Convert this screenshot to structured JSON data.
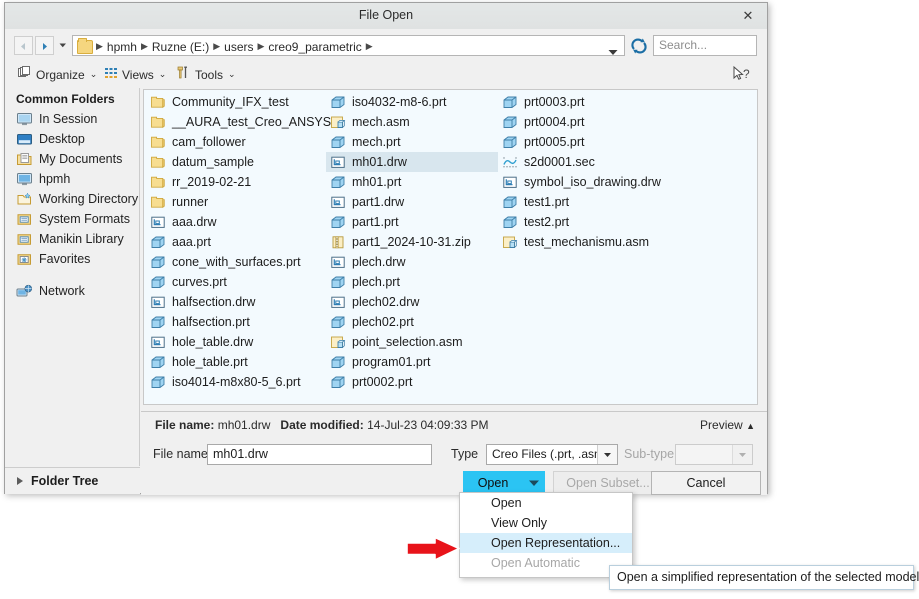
{
  "window": {
    "title": "File Open",
    "close_label": "✕"
  },
  "address": {
    "back_icon": "back-arrow-icon",
    "forward_icon": "forward-arrow-icon",
    "history_icon": "chevron-down-icon",
    "crumbs": [
      "hpmh",
      "Ruzne (E:)",
      "users",
      "creo9_parametric"
    ],
    "separator": "▶",
    "dropdown_icon": "chevron-down-icon",
    "refresh_icon": "refresh-icon",
    "search_placeholder": "Search..."
  },
  "toolstrip": {
    "items": [
      {
        "label": "Organize",
        "icon": "organize-icon",
        "caret": "⌄"
      },
      {
        "label": "Views",
        "icon": "views-grid-icon",
        "caret": "⌄"
      },
      {
        "label": "Tools",
        "icon": "tools-hammer-icon",
        "caret": "⌄"
      }
    ],
    "help_icon": "cursor-help-icon"
  },
  "sidebar": {
    "header": "Common Folders",
    "items": [
      {
        "label": "In Session",
        "icon": "monitor-icon"
      },
      {
        "label": "Desktop",
        "icon": "desktop-icon"
      },
      {
        "label": "My Documents",
        "icon": "documents-folder-icon"
      },
      {
        "label": "hpmh",
        "icon": "monitor-icon"
      },
      {
        "label": "Working Directory",
        "icon": "working-folder-icon"
      },
      {
        "label": "System Formats",
        "icon": "formats-folder-icon"
      },
      {
        "label": "Manikin Library",
        "icon": "library-folder-icon"
      },
      {
        "label": "Favorites",
        "icon": "favorites-folder-icon"
      }
    ],
    "network": {
      "label": "Network",
      "icon": "network-icon"
    },
    "folder_tree": {
      "label": "Folder Tree",
      "expander": "▶"
    }
  },
  "filelist": {
    "columns": [
      [
        {
          "name": "Community_IFX_test",
          "icon": "folder-icon",
          "selected": false
        },
        {
          "name": "__AURA_test_Creo_ANSYS",
          "icon": "folder-icon",
          "selected": false
        },
        {
          "name": "cam_follower",
          "icon": "folder-icon",
          "selected": false
        },
        {
          "name": "datum_sample",
          "icon": "folder-icon",
          "selected": false
        },
        {
          "name": "rr_2019-02-21",
          "icon": "folder-icon",
          "selected": false
        },
        {
          "name": "runner",
          "icon": "folder-icon",
          "selected": false
        },
        {
          "name": "aaa.drw",
          "icon": "drawing-icon",
          "selected": false
        },
        {
          "name": "aaa.prt",
          "icon": "part-icon",
          "selected": false
        },
        {
          "name": "cone_with_surfaces.prt",
          "icon": "part-icon",
          "selected": false
        },
        {
          "name": "curves.prt",
          "icon": "part-icon",
          "selected": false
        },
        {
          "name": "halfsection.drw",
          "icon": "drawing-icon",
          "selected": false
        },
        {
          "name": "halfsection.prt",
          "icon": "part-icon",
          "selected": false
        },
        {
          "name": "hole_table.drw",
          "icon": "drawing-icon",
          "selected": false
        },
        {
          "name": "hole_table.prt",
          "icon": "part-icon",
          "selected": false
        },
        {
          "name": "iso4014-m8x80-5_6.prt",
          "icon": "part-icon",
          "selected": false
        }
      ],
      [
        {
          "name": "iso4032-m8-6.prt",
          "icon": "part-icon",
          "selected": false
        },
        {
          "name": "mech.asm",
          "icon": "assembly-icon",
          "selected": false
        },
        {
          "name": "mech.prt",
          "icon": "part-icon",
          "selected": false
        },
        {
          "name": "mh01.drw",
          "icon": "drawing-icon",
          "selected": true
        },
        {
          "name": "mh01.prt",
          "icon": "part-icon",
          "selected": false
        },
        {
          "name": "part1.drw",
          "icon": "drawing-icon",
          "selected": false
        },
        {
          "name": "part1.prt",
          "icon": "part-icon",
          "selected": false
        },
        {
          "name": "part1_2024-10-31.zip",
          "icon": "zip-icon",
          "selected": false
        },
        {
          "name": "plech.drw",
          "icon": "drawing-icon",
          "selected": false
        },
        {
          "name": "plech.prt",
          "icon": "part-icon",
          "selected": false
        },
        {
          "name": "plech02.drw",
          "icon": "drawing-icon",
          "selected": false
        },
        {
          "name": "plech02.prt",
          "icon": "part-icon",
          "selected": false
        },
        {
          "name": "point_selection.asm",
          "icon": "assembly-icon",
          "selected": false
        },
        {
          "name": "program01.prt",
          "icon": "part-icon",
          "selected": false
        },
        {
          "name": "prt0002.prt",
          "icon": "part-icon",
          "selected": false
        }
      ],
      [
        {
          "name": "prt0003.prt",
          "icon": "part-icon",
          "selected": false
        },
        {
          "name": "prt0004.prt",
          "icon": "part-icon",
          "selected": false
        },
        {
          "name": "prt0005.prt",
          "icon": "part-icon",
          "selected": false
        },
        {
          "name": "s2d0001.sec",
          "icon": "sketch-icon",
          "selected": false
        },
        {
          "name": "symbol_iso_drawing.drw",
          "icon": "drawing-icon",
          "selected": false
        },
        {
          "name": "test1.prt",
          "icon": "part-icon",
          "selected": false
        },
        {
          "name": "test2.prt",
          "icon": "part-icon",
          "selected": false
        },
        {
          "name": "test_mechanismu.asm",
          "icon": "assembly-icon",
          "selected": false
        }
      ]
    ]
  },
  "details": {
    "file_name_label": "File name:",
    "file_name_value": "mh01.drw",
    "date_modified_label": "Date modified:",
    "date_modified_value": "14-Jul-23 04:09:33 PM",
    "preview_label": "Preview",
    "preview_caret": "▲"
  },
  "form": {
    "file_name_label": "File name:",
    "file_name_value": "mh01.drw",
    "type_label": "Type",
    "type_value": "Creo Files (.prt, .asm,",
    "subtype_label": "Sub-type",
    "subtype_value": ""
  },
  "buttons": {
    "open": "Open",
    "open_arrow_icon": "chevron-down-icon",
    "open_subset": "Open Subset...",
    "cancel": "Cancel"
  },
  "dropdown_menu": {
    "items": [
      {
        "label": "Open",
        "highlighted": false,
        "disabled": false
      },
      {
        "label": "View Only",
        "highlighted": false,
        "disabled": false
      },
      {
        "label": "Open Representation...",
        "highlighted": true,
        "disabled": false
      },
      {
        "label": "Open Automatic",
        "highlighted": false,
        "disabled": true
      }
    ]
  },
  "tooltip": {
    "text": "Open a simplified representation of the selected model"
  },
  "annotation": {
    "arrow_icon": "red-right-arrow-annotation",
    "arrow_color": "#e8131a"
  },
  "colors": {
    "accent": "#2bc4f3",
    "selection": "#d8e6ee",
    "menu_highlight": "#d6eefb",
    "window_bg": "#f0f0f0",
    "list_bg": "#f3fafe"
  }
}
